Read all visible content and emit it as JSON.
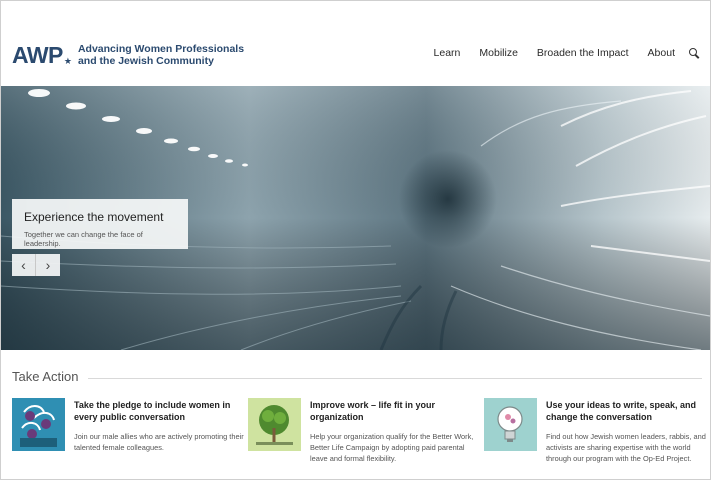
{
  "header": {
    "logo_mark": "AWP",
    "logo_line1": "Advancing Women Professionals",
    "logo_line2": "and the Jewish Community",
    "nav": [
      "Learn",
      "Mobilize",
      "Broaden the Impact",
      "About"
    ],
    "search_icon": "search-icon"
  },
  "hero": {
    "title": "Experience the movement",
    "subtitle": "Together we can change the face of leadership.",
    "prev_icon": "‹",
    "next_icon": "›"
  },
  "take_action": {
    "heading": "Take Action",
    "cards": [
      {
        "title": "Take the pledge to include women in every public conversation",
        "text": "Join our male allies who are actively promoting their talented female colleagues.",
        "icon": "pledge-illustration"
      },
      {
        "title": "Improve work – life fit in your organization",
        "text": "Help your organization qualify for the Better Work, Better Life Campaign by adopting paid parental leave and formal flexibility.",
        "icon": "tree-illustration"
      },
      {
        "title": "Use your ideas to write, speak, and change the conversation",
        "text": "Find out how Jewish women leaders, rabbis, and activists are sharing expertise with the world through our program with the Op-Ed Project.",
        "icon": "lightbulb-illustration"
      }
    ]
  },
  "colors": {
    "brand": "#2b4a6f",
    "hero_tint": "#6e8894",
    "card1_bg": "#2f8fb3",
    "card2_bg": "#cfe3a0",
    "card3_bg": "#9ed2cf"
  }
}
